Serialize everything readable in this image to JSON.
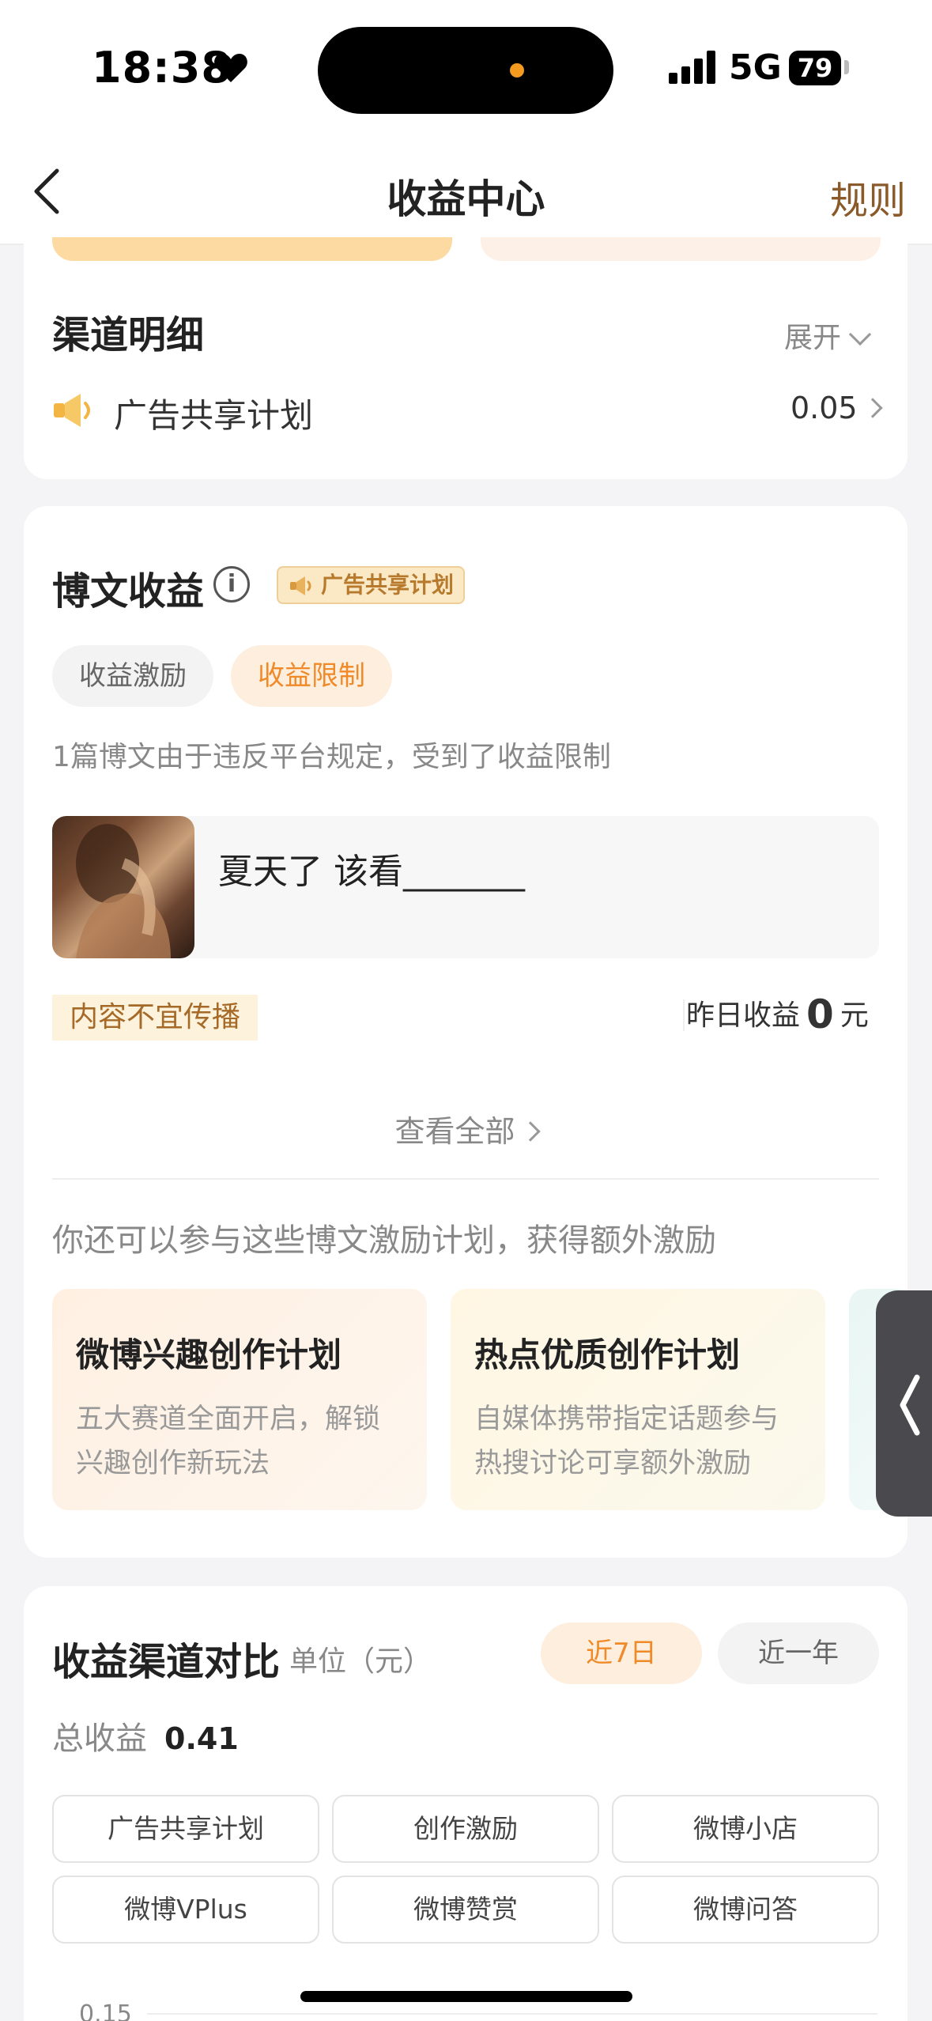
{
  "status": {
    "time": "18:38",
    "network": "5G",
    "battery": "79"
  },
  "nav": {
    "title": "收益中心",
    "rules": "规则"
  },
  "channel": {
    "title": "渠道明细",
    "expand": "展开",
    "item_label": "广告共享计划",
    "item_value": "0.05"
  },
  "post_income": {
    "title": "博文收益",
    "badge": "广告共享计划",
    "tabs": [
      "收益激励",
      "收益限制"
    ],
    "active_tab": "收益限制",
    "limit_text": "1篇博文由于违反平台规定，受到了收益限制",
    "post_title": "夏天了 该看_______",
    "warn_tag": "内容不宜传播",
    "yesterday_label": "昨日收益",
    "yesterday_value": "0",
    "yesterday_unit": "元",
    "view_all": "查看全部",
    "more_text": "你还可以参与这些博文激励计划，获得额外激励",
    "promos": [
      {
        "title": "微博兴趣创作计划",
        "desc1": "五大赛道全面开启，解锁",
        "desc2": "兴趣创作新玩法"
      },
      {
        "title": "热点优质创作计划",
        "desc1": "自媒体携带指定话题参与",
        "desc2": "热搜讨论可享额外激励"
      }
    ]
  },
  "compare": {
    "title": "收益渠道对比",
    "unit": "单位（元）",
    "ranges": [
      "近7日",
      "近一年"
    ],
    "active_range": "近7日",
    "total_label": "总收益",
    "total_value": "0.41",
    "channels": [
      "广告共享计划",
      "创作激励",
      "微博小店",
      "微博VPlus",
      "微博赞赏",
      "微博问答"
    ],
    "axis_tick": "0.15"
  },
  "colors": {
    "accent": "#f08a28",
    "rules": "#8a5a2a",
    "warn_bg": "#fdf2dc"
  }
}
